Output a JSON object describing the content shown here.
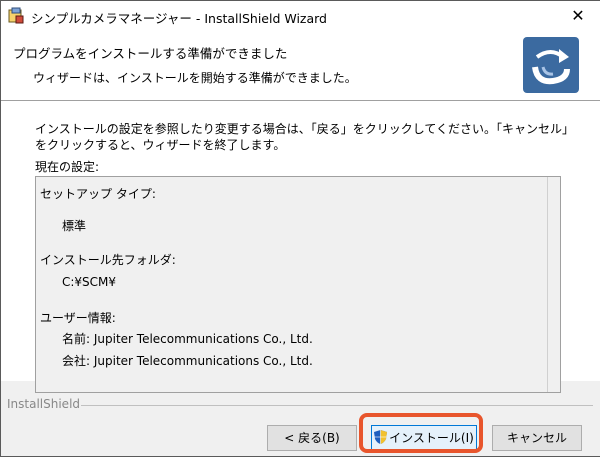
{
  "window": {
    "title": "シンプルカメラマネージャー - InstallShield Wizard",
    "close_glyph": "✕"
  },
  "header": {
    "title": "プログラムをインストールする準備ができました",
    "subtitle": "ウィザードは、インストールを開始する準備ができました。"
  },
  "main": {
    "instructions": "インストールの設定を参照したり変更する場合は、「戻る」をクリックしてください。「キャンセル」をクリックすると、ウィザードを終了します。",
    "current_settings_label": "現在の設定:",
    "settings": {
      "setup_type_label": "セットアップ タイプ:",
      "setup_type_value": "標準",
      "install_folder_label": "インストール先フォルダ:",
      "install_folder_value": "C:¥SCM¥",
      "user_info_label": "ユーザー情報:",
      "name_label_value": "名前: Jupiter Telecommunications Co., Ltd.",
      "company_label_value": "会社: Jupiter Telecommunications Co., Ltd."
    }
  },
  "footer": {
    "brand": "InstallShield",
    "back_label": "< 戻る(B)",
    "install_label": "インストール(I)",
    "cancel_label": "キャンセル"
  },
  "colors": {
    "highlight": "#e8552c",
    "logo_bg": "#3b6aa0"
  }
}
